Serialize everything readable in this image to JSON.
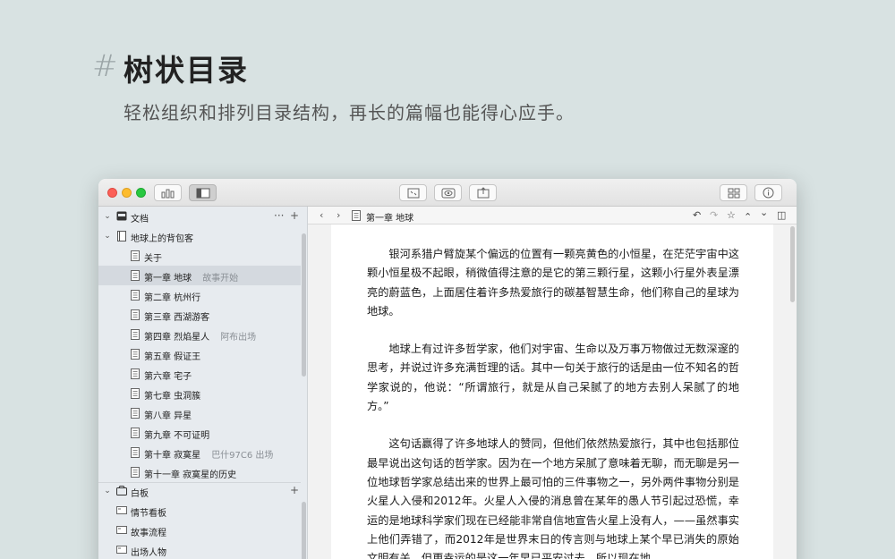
{
  "hero": {
    "hash": "#",
    "title": "树状目录",
    "subtitle": "轻松组织和排列目录结构，再长的篇幅也能得心应手。"
  },
  "toolbar": {
    "stats_icon": "bar-chart-icon",
    "sidebar_toggle_icon": "sidebar-icon",
    "focus_icon": "focus-icon",
    "preview_icon": "eye-icon",
    "share_icon": "share-icon",
    "grid_icon": "grid-icon",
    "info_icon": "info-icon"
  },
  "sidebar": {
    "documents_section": {
      "label": "文档",
      "more": "···",
      "add": "+"
    },
    "notebook": {
      "label": "地球上的背包客"
    },
    "chapters": [
      {
        "label": "关于",
        "sub": ""
      },
      {
        "label": "第一章 地球",
        "sub": "故事开始"
      },
      {
        "label": "第二章 杭州行",
        "sub": ""
      },
      {
        "label": "第三章 西湖游客",
        "sub": ""
      },
      {
        "label": "第四章 烈焰星人",
        "sub": "阿布出场"
      },
      {
        "label": "第五章 假证王",
        "sub": ""
      },
      {
        "label": "第六章 宅子",
        "sub": ""
      },
      {
        "label": "第七章 虫洞簇",
        "sub": ""
      },
      {
        "label": "第八章 异星",
        "sub": ""
      },
      {
        "label": "第九章 不可证明",
        "sub": ""
      },
      {
        "label": "第十章 寂寞星",
        "sub": "巴什97C6 出场"
      },
      {
        "label": "第十一章 寂寞星的历史",
        "sub": ""
      }
    ],
    "whiteboard_section": {
      "label": "白板",
      "add": "+"
    },
    "boards": [
      {
        "label": "情节看板"
      },
      {
        "label": "故事流程"
      },
      {
        "label": "出场人物"
      }
    ]
  },
  "editor": {
    "back": "‹",
    "forward": "›",
    "breadcrumb": "第一章 地球",
    "undo": "↶",
    "redo": "↷",
    "star": "☆",
    "up": "⌃",
    "down": "⌄",
    "split": "◫",
    "paragraphs": [
      "银河系猎户臂旋某个偏远的位置有一颗亮黄色的小恒星，在茫茫宇宙中这颗小恒星极不起眼，稍微值得注意的是它的第三颗行星，这颗小行星外表呈漂亮的蔚蓝色，上面居住着许多热爱旅行的碳基智慧生命，他们称自己的星球为地球。",
      "地球上有过许多哲学家，他们对宇宙、生命以及万事万物做过无数深邃的思考，并说过许多充满哲理的话。其中一句关于旅行的话是由一位不知名的哲学家说的，他说：“所谓旅行，就是从自己呆腻了的地方去别人呆腻了的地方。”",
      "这句话赢得了许多地球人的赞同，但他们依然热爱旅行，其中也包括那位最早说出这句话的哲学家。因为在一个地方呆腻了意味着无聊，而无聊是另一位地球哲学家总结出来的世界上最可怕的三件事物之一，另外两件事物分别是火星人入侵和2012年。火星人入侵的消息曾在某年的愚人节引起过恐慌，幸运的是地球科学家们现在已经能非常自信地宣告火星上没有人，——虽然事实上他们弄错了，而2012年是世界末日的传言则与地球上某个早已消失的原始文明有关，但更幸运的是这一年早已平安过去，所以现在地"
    ]
  }
}
